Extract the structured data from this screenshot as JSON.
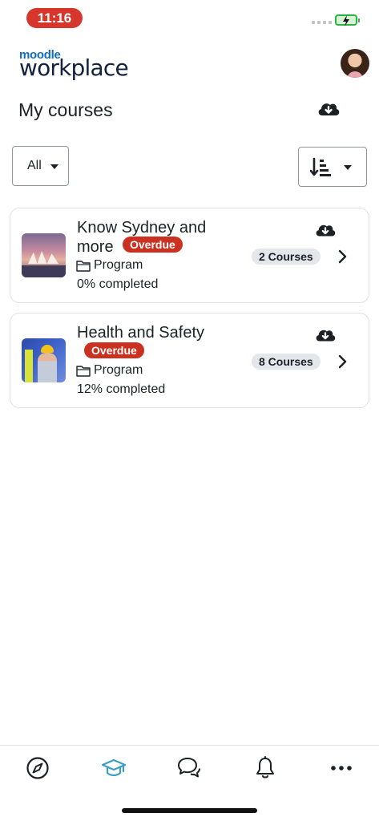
{
  "status_bar": {
    "time": "11:16"
  },
  "header": {
    "logo_small": "moodle",
    "logo_big": "workplace"
  },
  "page": {
    "title": "My courses"
  },
  "filters": {
    "selected": "All"
  },
  "courses": [
    {
      "title_line1": "Know Sydney and",
      "title_line2": "more",
      "status": "Overdue",
      "type": "Program",
      "progress": "0% completed",
      "count": "2 Courses"
    },
    {
      "title_line1": "Health and Safety",
      "title_line2": "",
      "status": "Overdue",
      "type": "Program",
      "progress": "12% completed",
      "count": "8 Courses"
    }
  ],
  "tabs": [
    {
      "icon": "compass-icon",
      "active": false
    },
    {
      "icon": "graduation-cap-icon",
      "active": true
    },
    {
      "icon": "chat-bubbles-icon",
      "active": false
    },
    {
      "icon": "bell-icon",
      "active": false
    },
    {
      "icon": "more-dots-icon",
      "active": false
    }
  ],
  "colors": {
    "accent": "#0f6cbf",
    "overdue": "#ca3120",
    "active_tab": "#3a9ec7",
    "time_pill": "#d6362c"
  }
}
